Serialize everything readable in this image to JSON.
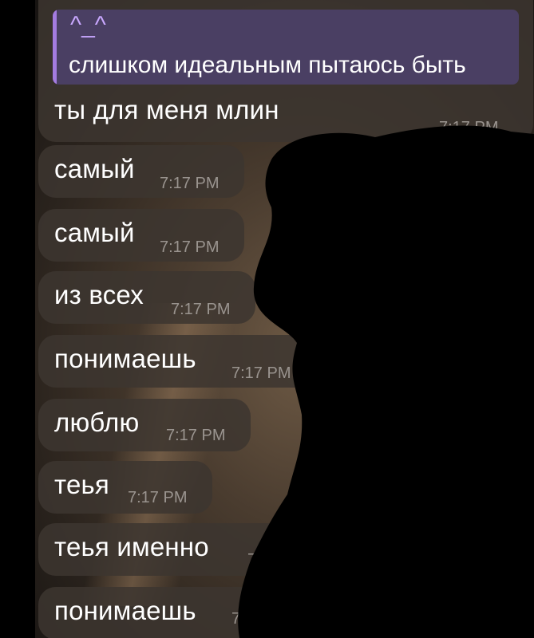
{
  "quoted_message": {
    "emoticon": "^_^",
    "text": "слишком идеальным пытаюсь быть"
  },
  "messages": [
    {
      "text": "ты для меня млин",
      "time": "7:17 PM"
    },
    {
      "text": "самый",
      "time": "7:17 PM"
    },
    {
      "text": "самый",
      "time": "7:17 PM"
    },
    {
      "text": "из всех",
      "time": "7:17 PM"
    },
    {
      "text": "понимаешь",
      "time": "7:17 PM"
    },
    {
      "text": "люблю",
      "time": "7:17 PM"
    },
    {
      "text": "теья",
      "time": "7:17 PM"
    },
    {
      "text": "теья именно",
      "time": "7:17 PM"
    },
    {
      "text": "понимаешь",
      "time": "7:17 PM"
    }
  ],
  "colors": {
    "bubble": "#3c3530",
    "quote_background": "#4a3f63",
    "quote_bar": "#a47ce0",
    "timestamp": "#9a948f",
    "redaction": "#000000"
  }
}
